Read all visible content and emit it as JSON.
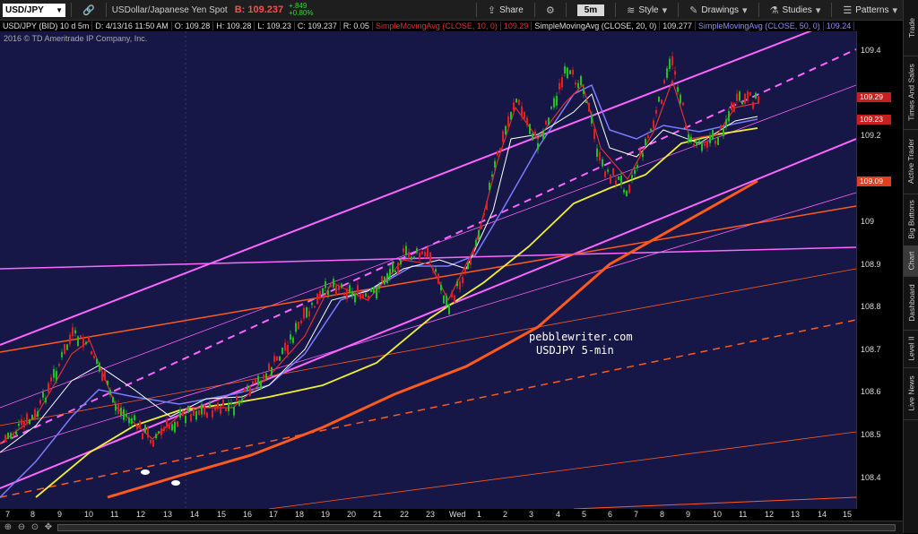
{
  "toolbar": {
    "symbol": "USD/JPY",
    "description": "USDollar/Japanese Yen Spot",
    "bid": "B: 109.237",
    "change_up": "+.849",
    "change_pct": "+0.80%",
    "share": "Share",
    "timeframe": "5m",
    "style": "Style",
    "drawings": "Drawings",
    "studies": "Studies",
    "patterns": "Patterns"
  },
  "infobar": {
    "instrument": "USD/JPY (BID) 10 d 5m",
    "date": "D: 4/13/16 11:50 AM",
    "open": "O: 109.28",
    "high": "H: 109.28",
    "low": "L: 109.23",
    "close": "C: 109.237",
    "range": "R: 0.05",
    "sma10": "SimpleMovingAvg (CLOSE, 10, 0)",
    "sma10_val": "109.29",
    "sma20": "SimpleMovingAvg (CLOSE, 20, 0)",
    "sma20_val": "109.277",
    "sma50": "SimpleMovingAvg (CLOSE, 50, 0)",
    "sma50_val": "109.24"
  },
  "copyright": "2016 © TD Ameritrade IP Company, Inc.",
  "watermark": {
    "line1": "pebblewriter.com",
    "line2": "USDJPY 5-min"
  },
  "price_ticks": [
    "109.4",
    "109.2",
    "109",
    "108.9",
    "108.8",
    "108.7",
    "108.6",
    "108.5",
    "108.4"
  ],
  "price_tags": {
    "sma10": "109.29",
    "last": "109.23",
    "orange": "109.09"
  },
  "time_labels": [
    "7",
    "8",
    "9",
    "10",
    "11",
    "12",
    "13",
    "14",
    "15",
    "16",
    "17",
    "18",
    "19",
    "20",
    "21",
    "22",
    "23",
    "Wed",
    "1",
    "2",
    "3",
    "4",
    "5",
    "6",
    "7",
    "8",
    "9",
    "10",
    "11",
    "12",
    "13",
    "14",
    "15"
  ],
  "sidebar": [
    "Trade",
    "Times And Sales",
    "Active Trader",
    "Big Buttons",
    "Chart",
    "Dashboard",
    "Level II",
    "Live News"
  ],
  "colors": {
    "background": "#171747",
    "sma10": "#e03030",
    "sma20": "#ffffff",
    "sma50": "#7a7cff",
    "yellow_ma": "#f0f030",
    "orange_ma": "#ff5a1e",
    "channel": "#ff66ff",
    "up_candle": "#21c021",
    "down_candle": "#e02020"
  }
}
